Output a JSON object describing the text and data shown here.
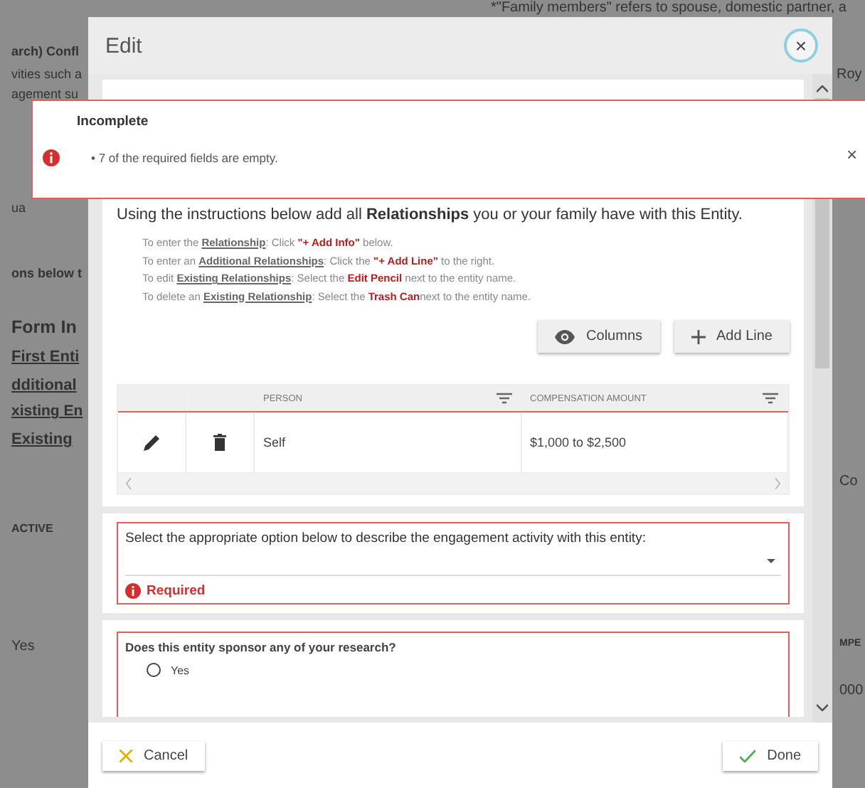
{
  "background": {
    "texts": [
      "*\"Family members\" refers to spouse, domestic partner, a",
      "arch) Confl",
      "vities such a",
      "agement su",
      "ua",
      "ons below t",
      "Form In",
      "First Enti",
      "dditional",
      "xisting En",
      "Existing",
      "ACTIVE",
      "Yes",
      "Roy",
      "Co",
      "MPE",
      "000"
    ]
  },
  "dialog": {
    "title": "Edit",
    "close": "×"
  },
  "toast": {
    "title": "Incomplete",
    "messages": [
      "• 7 of the required fields are empty."
    ],
    "close": "×"
  },
  "relationships": {
    "heading": "Using the instructions below add all **Relationships** you or your family have with this Entity.",
    "instructions": [
      [
        {
          "kind": "plain",
          "text": "To enter the "
        },
        {
          "kind": "link",
          "text": "Relationship"
        },
        {
          "kind": "plain",
          "text": ": Click "
        },
        {
          "kind": "red",
          "text": "\"+ Add Info\""
        },
        {
          "kind": "plain",
          "text": " below."
        }
      ],
      [
        {
          "kind": "plain",
          "text": "To enter an "
        },
        {
          "kind": "link",
          "text": "Additional Relationships"
        },
        {
          "kind": "plain",
          "text": ": Click the "
        },
        {
          "kind": "red",
          "text": "\"+ Add Line\""
        },
        {
          "kind": "plain",
          "text": " to the right."
        }
      ],
      [
        {
          "kind": "plain",
          "text": "To edit "
        },
        {
          "kind": "link",
          "text": "Existing Relationships"
        },
        {
          "kind": "plain",
          "text": ": Select the "
        },
        {
          "kind": "red",
          "text": "Edit Pencil"
        },
        {
          "kind": "plain",
          "text": " next to the entity name."
        }
      ],
      [
        {
          "kind": "plain",
          "text": "To delete an "
        },
        {
          "kind": "link",
          "text": "Existing Relationship"
        },
        {
          "kind": "plain",
          "text": ": Select the "
        },
        {
          "kind": "red",
          "text": "Trash Can"
        },
        {
          "kind": "plain",
          "text": "next to the entity name."
        }
      ]
    ],
    "buttons": [
      "Columns",
      "Add Line"
    ],
    "table": {
      "columns": [
        "PERSON",
        "COMPENSATION AMOUNT"
      ],
      "rows": [
        {
          "person": "Self",
          "amount": "$1,000 to $2,500"
        }
      ]
    }
  },
  "engagement": {
    "label": "Select the appropriate option below to describe the engagement activity with this entity:",
    "error": "Required"
  },
  "sponsor": {
    "label": "Does this entity sponsor any of your research?",
    "options": [
      {
        "label": "Yes",
        "selected": false
      }
    ]
  },
  "footer": {
    "cancel": "Cancel",
    "done": "Done"
  }
}
